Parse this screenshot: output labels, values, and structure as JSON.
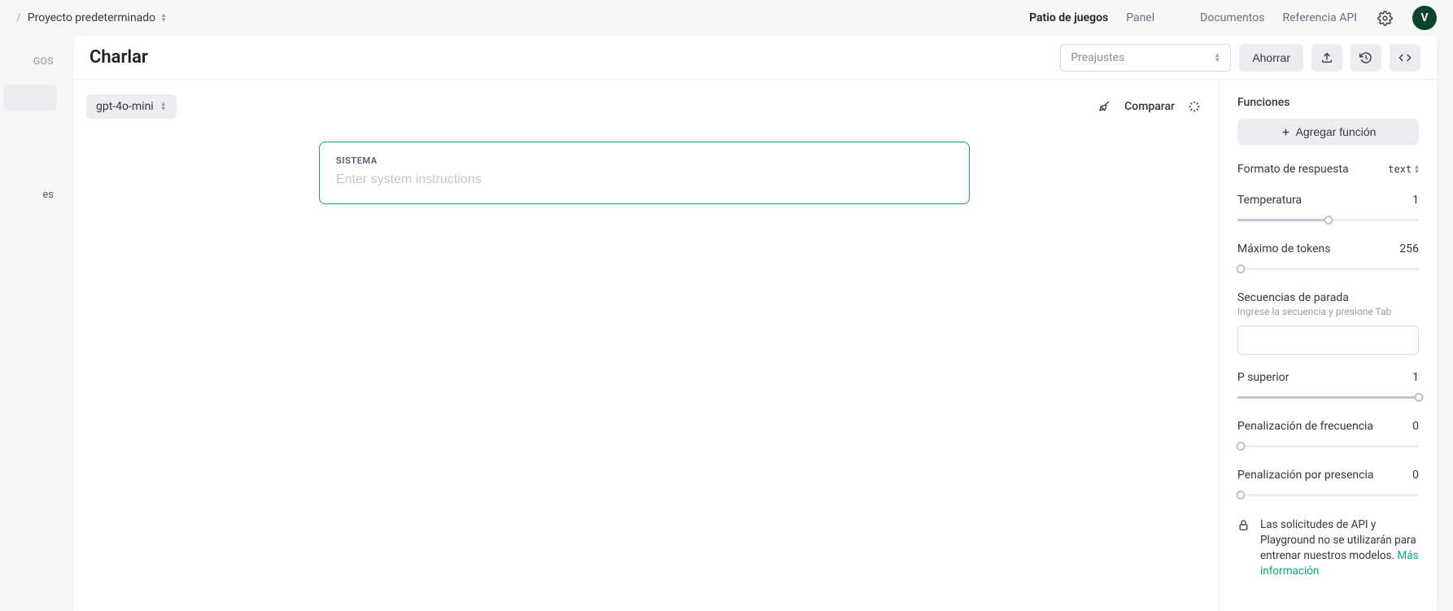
{
  "topbar": {
    "breadcrumb_sep": "/",
    "project_label": "Proyecto predeterminado",
    "nav": {
      "playground": "Patio de juegos",
      "panel": "Panel",
      "docs": "Documentos",
      "api_ref": "Referencia API"
    },
    "avatar_initial": "V"
  },
  "sidebar": {
    "heading_fragment": "GOS",
    "item_fragment": "es"
  },
  "header": {
    "title": "Charlar",
    "presets_placeholder": "Preajustes",
    "save_label": "Ahorrar"
  },
  "content": {
    "model_label": "gpt-4o-mini",
    "compare_label": "Comparar",
    "system_section_label": "SISTEMA",
    "system_placeholder": "Enter system instructions"
  },
  "settings": {
    "functions_label": "Funciones",
    "add_function_label": "Agregar función",
    "response_format_label": "Formato de respuesta",
    "response_format_value": "text",
    "temperature_label": "Temperatura",
    "temperature_value": "1",
    "max_tokens_label": "Máximo de tokens",
    "max_tokens_value": "256",
    "stop_sequences_label": "Secuencias de parada",
    "stop_sequences_hint": "Ingrese la secuencia y presione Tab",
    "top_p_label": "P superior",
    "top_p_value": "1",
    "freq_penalty_label": "Penalización de frecuencia",
    "freq_penalty_value": "0",
    "pres_penalty_label": "Penalización por presencia",
    "pres_penalty_value": "0",
    "notice_text": "Las solicitudes de API y Playground no se utilizarán para entrenar nuestros modelos.",
    "notice_link": "Más información"
  }
}
